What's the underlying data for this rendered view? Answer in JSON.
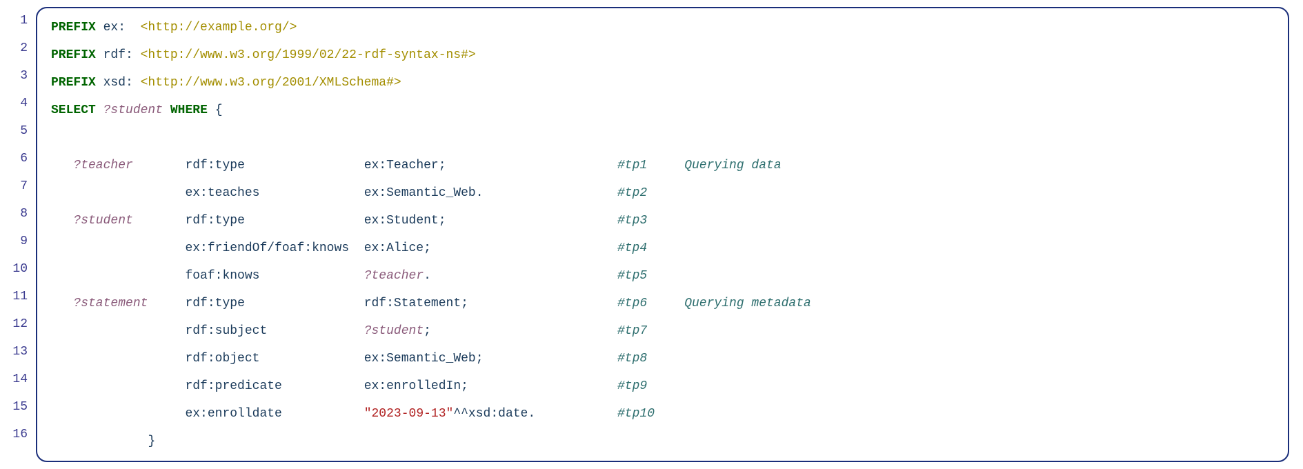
{
  "lines": [
    {
      "n": "1",
      "segments": [
        {
          "cls": "kw",
          "text": "PREFIX"
        },
        {
          "cls": "plain",
          "text": " ex:  "
        },
        {
          "cls": "uri",
          "text": "<http://example.org/>"
        }
      ]
    },
    {
      "n": "2",
      "segments": [
        {
          "cls": "kw",
          "text": "PREFIX"
        },
        {
          "cls": "plain",
          "text": " rdf: "
        },
        {
          "cls": "uri",
          "text": "<http://www.w3.org/1999/02/22-rdf-syntax-ns#>"
        }
      ]
    },
    {
      "n": "3",
      "segments": [
        {
          "cls": "kw",
          "text": "PREFIX"
        },
        {
          "cls": "plain",
          "text": " xsd: "
        },
        {
          "cls": "uri",
          "text": "<http://www.w3.org/2001/XMLSchema#>"
        }
      ]
    },
    {
      "n": "4",
      "segments": [
        {
          "cls": "kw",
          "text": "SELECT"
        },
        {
          "cls": "plain",
          "text": " "
        },
        {
          "cls": "var",
          "text": "?student"
        },
        {
          "cls": "plain",
          "text": " "
        },
        {
          "cls": "kw",
          "text": "WHERE"
        },
        {
          "cls": "plain",
          "text": " "
        },
        {
          "cls": "brace",
          "text": "{"
        }
      ]
    },
    {
      "n": "5",
      "segments": [
        {
          "cls": "plain",
          "text": ""
        }
      ]
    },
    {
      "n": "6",
      "segments": [
        {
          "cls": "plain",
          "text": "   "
        },
        {
          "cls": "var",
          "text": "?teacher"
        },
        {
          "cls": "plain",
          "text": "       "
        },
        {
          "cls": "pred",
          "text": "rdf:type"
        },
        {
          "cls": "plain",
          "text": "                "
        },
        {
          "cls": "obj",
          "text": "ex:Teacher;"
        },
        {
          "cls": "plain",
          "text": "                       "
        },
        {
          "cls": "comment",
          "text": "#tp1     Querying data"
        }
      ]
    },
    {
      "n": "7",
      "segments": [
        {
          "cls": "plain",
          "text": "                  "
        },
        {
          "cls": "pred",
          "text": "ex:teaches"
        },
        {
          "cls": "plain",
          "text": "              "
        },
        {
          "cls": "obj",
          "text": "ex:Semantic_Web."
        },
        {
          "cls": "plain",
          "text": "                  "
        },
        {
          "cls": "comment",
          "text": "#tp2"
        }
      ]
    },
    {
      "n": "8",
      "segments": [
        {
          "cls": "plain",
          "text": "   "
        },
        {
          "cls": "var",
          "text": "?student"
        },
        {
          "cls": "plain",
          "text": "       "
        },
        {
          "cls": "pred",
          "text": "rdf:type"
        },
        {
          "cls": "plain",
          "text": "                "
        },
        {
          "cls": "obj",
          "text": "ex:Student;"
        },
        {
          "cls": "plain",
          "text": "                       "
        },
        {
          "cls": "comment",
          "text": "#tp3"
        }
      ]
    },
    {
      "n": "9",
      "segments": [
        {
          "cls": "plain",
          "text": "                  "
        },
        {
          "cls": "pred",
          "text": "ex:friendOf/foaf:knows"
        },
        {
          "cls": "plain",
          "text": "  "
        },
        {
          "cls": "obj",
          "text": "ex:Alice;"
        },
        {
          "cls": "plain",
          "text": "                         "
        },
        {
          "cls": "comment",
          "text": "#tp4"
        }
      ]
    },
    {
      "n": "10",
      "segments": [
        {
          "cls": "plain",
          "text": "                  "
        },
        {
          "cls": "pred",
          "text": "foaf:knows"
        },
        {
          "cls": "plain",
          "text": "              "
        },
        {
          "cls": "var",
          "text": "?teacher"
        },
        {
          "cls": "obj",
          "text": "."
        },
        {
          "cls": "plain",
          "text": "                         "
        },
        {
          "cls": "comment",
          "text": "#tp5"
        }
      ]
    },
    {
      "n": "11",
      "segments": [
        {
          "cls": "plain",
          "text": "   "
        },
        {
          "cls": "var",
          "text": "?statement"
        },
        {
          "cls": "plain",
          "text": "     "
        },
        {
          "cls": "pred",
          "text": "rdf:type"
        },
        {
          "cls": "plain",
          "text": "                "
        },
        {
          "cls": "obj",
          "text": "rdf:Statement;"
        },
        {
          "cls": "plain",
          "text": "                    "
        },
        {
          "cls": "comment",
          "text": "#tp6     Querying metadata"
        }
      ]
    },
    {
      "n": "12",
      "segments": [
        {
          "cls": "plain",
          "text": "                  "
        },
        {
          "cls": "pred",
          "text": "rdf:subject"
        },
        {
          "cls": "plain",
          "text": "             "
        },
        {
          "cls": "var",
          "text": "?student"
        },
        {
          "cls": "obj",
          "text": ";"
        },
        {
          "cls": "plain",
          "text": "                         "
        },
        {
          "cls": "comment",
          "text": "#tp7"
        }
      ]
    },
    {
      "n": "13",
      "segments": [
        {
          "cls": "plain",
          "text": "                  "
        },
        {
          "cls": "pred",
          "text": "rdf:object"
        },
        {
          "cls": "plain",
          "text": "              "
        },
        {
          "cls": "obj",
          "text": "ex:Semantic_Web;"
        },
        {
          "cls": "plain",
          "text": "                  "
        },
        {
          "cls": "comment",
          "text": "#tp8"
        }
      ]
    },
    {
      "n": "14",
      "segments": [
        {
          "cls": "plain",
          "text": "                  "
        },
        {
          "cls": "pred",
          "text": "rdf:predicate"
        },
        {
          "cls": "plain",
          "text": "           "
        },
        {
          "cls": "obj",
          "text": "ex:enrolledIn;"
        },
        {
          "cls": "plain",
          "text": "                    "
        },
        {
          "cls": "comment",
          "text": "#tp9"
        }
      ]
    },
    {
      "n": "15",
      "segments": [
        {
          "cls": "plain",
          "text": "                  "
        },
        {
          "cls": "pred",
          "text": "ex:enrolldate"
        },
        {
          "cls": "plain",
          "text": "           "
        },
        {
          "cls": "str",
          "text": "\"2023-09-13\""
        },
        {
          "cls": "obj",
          "text": "^^xsd:date."
        },
        {
          "cls": "plain",
          "text": "           "
        },
        {
          "cls": "comment",
          "text": "#tp10"
        }
      ]
    },
    {
      "n": "16",
      "segments": [
        {
          "cls": "plain",
          "text": "             "
        },
        {
          "cls": "brace",
          "text": "}"
        }
      ]
    }
  ]
}
